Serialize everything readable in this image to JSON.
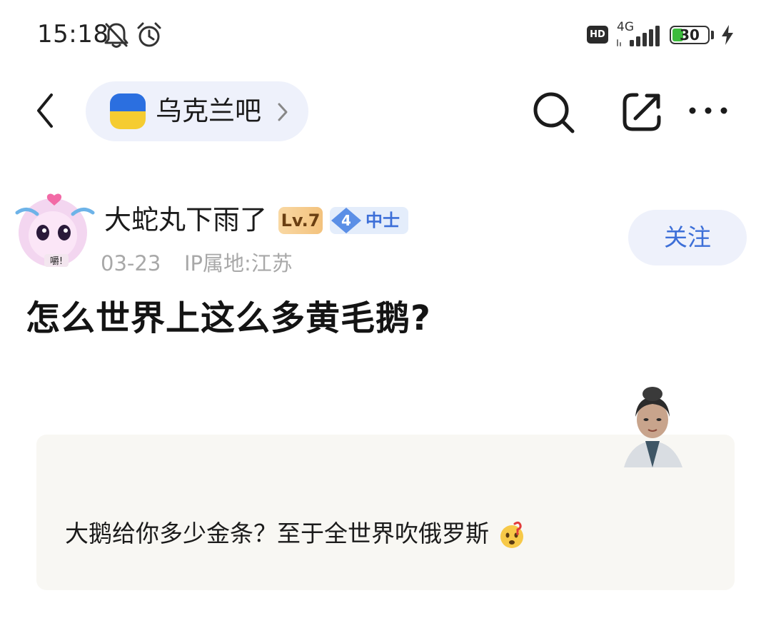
{
  "status_bar": {
    "time": "15:18",
    "network_type": "4G",
    "hd_label": "HD",
    "battery": "30",
    "icons": [
      "bell-off-icon",
      "alarm-icon",
      "signal-icon",
      "bolt-icon"
    ]
  },
  "nav": {
    "forum_name": "乌克兰吧",
    "icons": [
      "back-icon",
      "flag-icon",
      "chevron-right-icon",
      "search-icon",
      "share-icon",
      "more-icon"
    ]
  },
  "author": {
    "name": "大蛇丸下雨了",
    "level": "Lv.7",
    "rank_level": "4",
    "rank_name": "中士",
    "date": "03-23",
    "ip_location": "IP属地:江苏",
    "follow_label": "关注"
  },
  "post": {
    "title": "怎么世界上这么多黄毛鹅?",
    "quote_text": "大鹅给你多少金条？至于全世界吹俄罗斯"
  },
  "colors": {
    "accent": "#3d6fd8",
    "chip_bg": "#eef1fb",
    "quote_bg": "#f8f7f3",
    "meta_gray": "#a8a8a8",
    "flag_blue": "#2b6fe0",
    "flag_yellow": "#f5cc31",
    "battery_green": "#3dbb3d"
  }
}
